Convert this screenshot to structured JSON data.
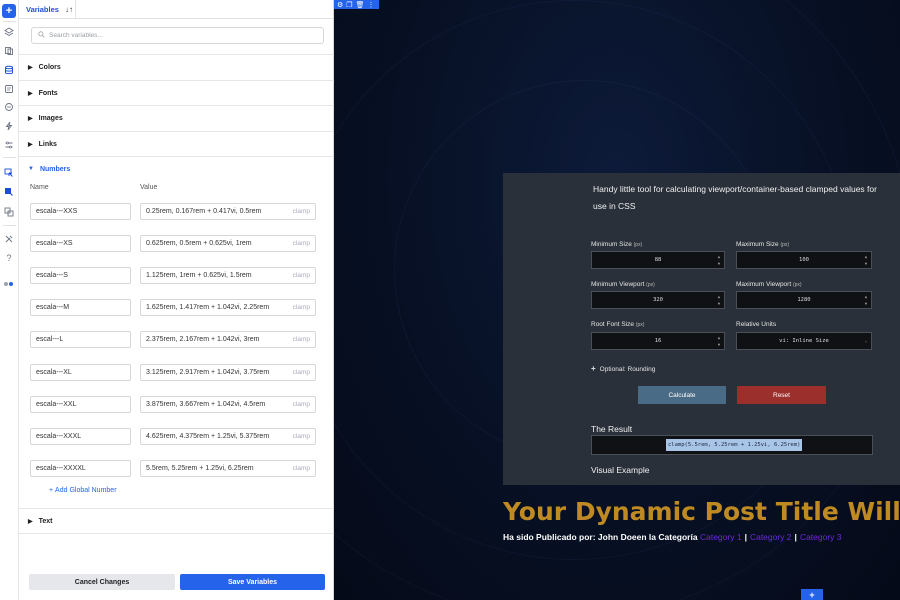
{
  "rail": {
    "icons": [
      "add-icon",
      "layers-icon",
      "pages-icon",
      "database-icon",
      "form-icon",
      "templates-icon",
      "lightning-icon",
      "sliders-icon",
      "cursor-icon",
      "variables-icon",
      "components-icon",
      "tools-icon",
      "help-icon",
      "toggle-icon"
    ]
  },
  "panel": {
    "tab_label": "Variables",
    "sort_icon": "↓↑",
    "search_placeholder": "Search variables...",
    "sections": {
      "colors": "Colors",
      "fonts": "Fonts",
      "images": "Images",
      "links": "Links",
      "numbers": "Numbers",
      "text": "Text"
    },
    "columns": {
      "name": "Name",
      "value": "Value"
    },
    "numbers": [
      {
        "name": "escala---XXS",
        "value": "0.25rem, 0.167rem + 0.417vi, 0.5rem",
        "tag": "clamp"
      },
      {
        "name": "escala---XS",
        "value": "0.625rem, 0.5rem + 0.625vi, 1rem",
        "tag": "clamp"
      },
      {
        "name": "escala---S",
        "value": "1.125rem, 1rem + 0.625vi, 1.5rem",
        "tag": "clamp"
      },
      {
        "name": "escala---M",
        "value": "1.625rem, 1.417rem + 1.042vi, 2.25rem",
        "tag": "clamp"
      },
      {
        "name": "escal---L",
        "value": "2.375rem, 2.167rem + 1.042vi, 3rem",
        "tag": "clamp"
      },
      {
        "name": "escala---XL",
        "value": "3.125rem, 2.917rem + 1.042vi, 3.75rem",
        "tag": "clamp"
      },
      {
        "name": "escala---XXL",
        "value": "3.875rem, 3.667rem + 1.042vi, 4.5rem",
        "tag": "clamp"
      },
      {
        "name": "escala---XXXL",
        "value": "4.625rem, 4.375rem + 1.25vi, 5.375rem",
        "tag": "clamp"
      },
      {
        "name": "escala---XXXXL",
        "value": "5.5rem, 5.25rem + 1.25vi, 6.25rem",
        "tag": "clamp"
      }
    ],
    "add_number": "Add Global Number",
    "cancel": "Cancel Changes",
    "save": "Save Variables"
  },
  "canvas": {
    "toolbar_icons": [
      "gear-icon",
      "duplicate-icon",
      "trash-icon",
      "more-icon"
    ],
    "calculator": {
      "description": "Handy little tool for calculating viewport/container-based clamped values for use in CSS",
      "min_size_label": "Minimum Size",
      "max_size_label": "Maximum Size",
      "min_vp_label": "Minimum Viewport",
      "max_vp_label": "Maximum Viewport",
      "root_font_label": "Root Font Size",
      "units_label": "Relative Units",
      "px": "(px)",
      "min_size": "88",
      "max_size": "100",
      "min_vp": "320",
      "max_vp": "1280",
      "root_font": "16",
      "units": "vi: Inline Size",
      "optional": "Optional: Rounding",
      "calculate": "Calculate",
      "reset": "Reset",
      "result_heading": "The Result",
      "result": "clamp(5.5rem, 5.25rem + 1.25vi, 6.25rem)",
      "visual_heading": "Visual Example"
    },
    "post": {
      "title": "Your Dynamic Post Title Will D",
      "meta_prefix": "Ha sido Publicado por: John Doeen la Categoría",
      "categories": [
        "Category 1",
        "Category 2",
        "Category 3"
      ],
      "sep": "|"
    },
    "add_button": "+"
  },
  "colors": {
    "accent": "#2563eb",
    "title_gold": "#c08a23",
    "category_purple": "#6d28d9",
    "reset_red": "#9b2f2c",
    "calc_blue": "#4a6b85"
  }
}
